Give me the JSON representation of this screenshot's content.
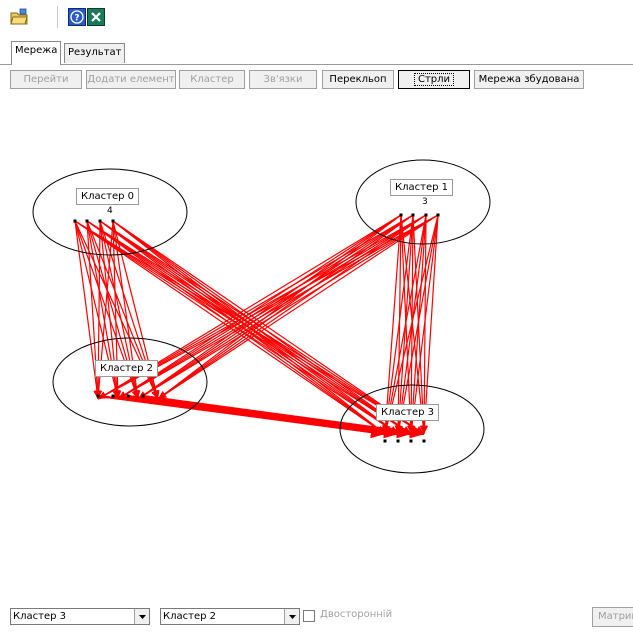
{
  "toolbar": {
    "icons": [
      "open-folder-icon",
      "help-icon",
      "exit-icon"
    ]
  },
  "tabs": [
    {
      "label": "Мережа",
      "active": true
    },
    {
      "label": "Результат",
      "active": false
    }
  ],
  "actions": [
    {
      "label": "Перейти",
      "enabled": false
    },
    {
      "label": "Додати елемент",
      "enabled": false
    },
    {
      "label": "Кластер",
      "enabled": false
    },
    {
      "label": "Зв'язки",
      "enabled": false
    },
    {
      "label": "Перекльоп",
      "enabled": true
    },
    {
      "label": "Стрли",
      "enabled": true,
      "focused": true
    },
    {
      "label": "Мережа збудована",
      "enabled": true
    }
  ],
  "network": {
    "link_color": "#ff0000",
    "clusters": [
      {
        "name": "Кластер 0",
        "count": "4"
      },
      {
        "name": "Кластер 1",
        "count": "3"
      },
      {
        "name": "Кластер 2",
        "count": ""
      },
      {
        "name": "Кластер 3",
        "count": ""
      }
    ]
  },
  "bottom": {
    "from_cluster": "Кластер 3",
    "to_cluster": "Кластер 2",
    "bidirectional_label": "Двосторонній",
    "bidirectional_checked": false,
    "matrix_button": "Матриця"
  }
}
